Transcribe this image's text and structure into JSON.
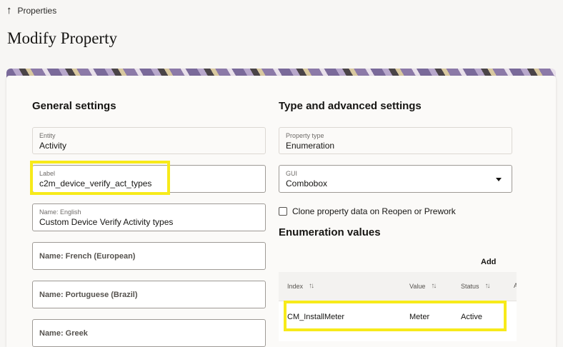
{
  "breadcrumb": {
    "back_label": "Properties"
  },
  "page": {
    "title": "Modify Property"
  },
  "general": {
    "title": "General settings",
    "entity": {
      "label": "Entity",
      "value": "Activity"
    },
    "label_field": {
      "label": "Label",
      "value": "c2m_device_verify_act_types"
    },
    "name_english": {
      "label": "Name: English",
      "value": "Custom Device Verify Activity types"
    },
    "name_french": {
      "label": "Name: French (European)"
    },
    "name_portuguese": {
      "label": "Name: Portuguese (Brazil)"
    },
    "name_greek": {
      "label": "Name: Greek"
    }
  },
  "advanced": {
    "title": "Type and advanced settings",
    "property_type": {
      "label": "Property type",
      "value": "Enumeration"
    },
    "gui": {
      "label": "GUI",
      "value": "Combobox"
    },
    "clone_label": "Clone property data on Reopen or Prework"
  },
  "enumeration": {
    "title": "Enumeration values",
    "add_label": "Add",
    "columns": [
      "Index",
      "Value",
      "Status",
      "A"
    ],
    "rows": [
      {
        "index": "CM_InstallMeter",
        "value": "Meter",
        "status": "Active"
      }
    ]
  },
  "colors": {
    "highlight": "#f7ea1a",
    "background": "#f7f6f4"
  }
}
